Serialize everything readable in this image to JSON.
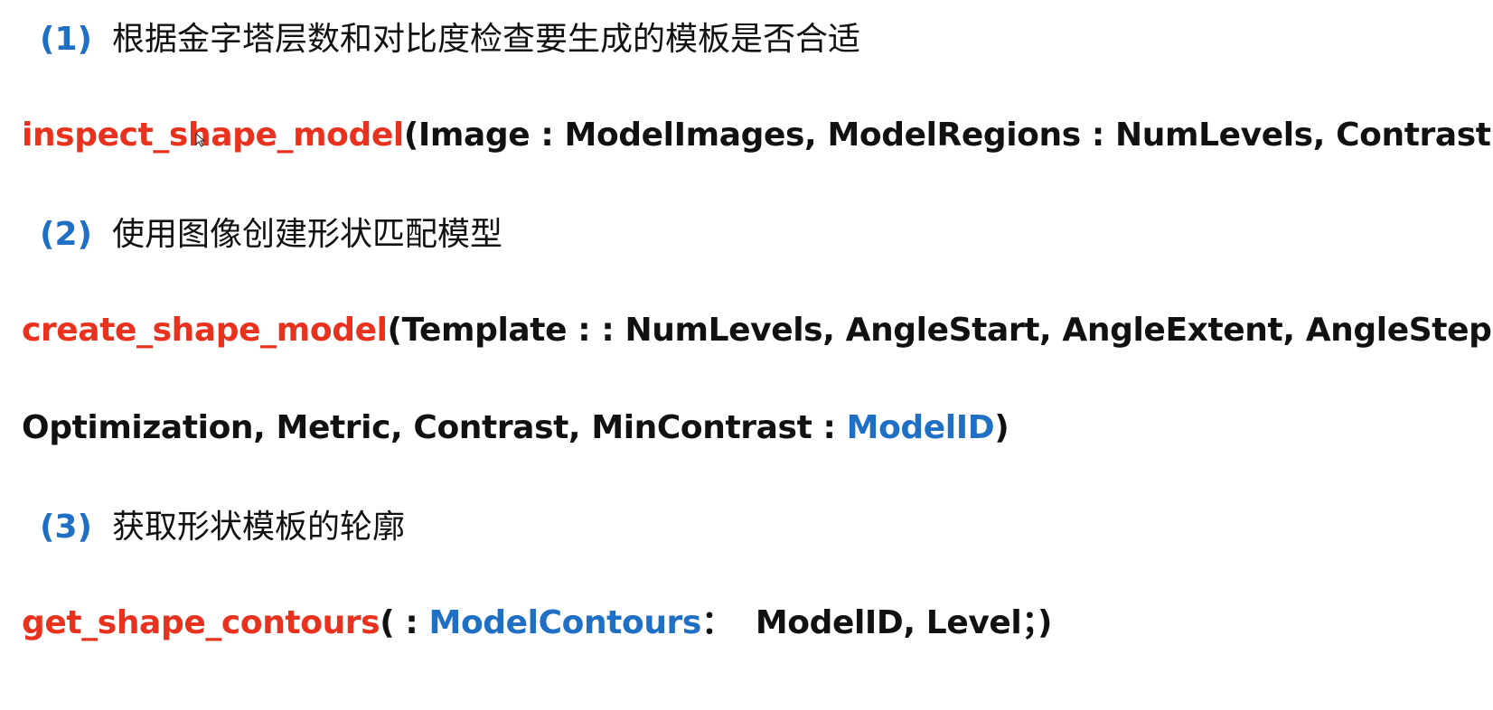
{
  "steps": [
    {
      "number": "(1)",
      "title": "根据金字塔层数和对比度检查要生成的模板是否合适",
      "code": {
        "function": "inspect_shape_model",
        "args": "(Image : ModelImages, ModelRegions : NumLevels, Contrast : )"
      }
    },
    {
      "number": "(2)",
      "title": "使用图像创建形状匹配模型",
      "code": {
        "function": "create_shape_model",
        "args_line1": "(Template : : NumLevels, AngleStart, AngleExtent, AngleStep,",
        "args_line2_prefix": "Optimization, Metric, Contrast, MinContrast : ",
        "output_param": "ModelID",
        "args_line2_suffix": ")"
      }
    },
    {
      "number": "(3)",
      "title": "获取形状模板的轮廓",
      "code": {
        "function": "get_shape_contours",
        "args_prefix": "( : ",
        "output_param": "ModelContours",
        "args_sep": "：",
        "args_suffix": "  ModelID, Level；)"
      }
    }
  ],
  "colors": {
    "function_name": "#e8321e",
    "output_param": "#1f6fc5",
    "step_number": "#1f6fc5",
    "text": "#111111"
  }
}
